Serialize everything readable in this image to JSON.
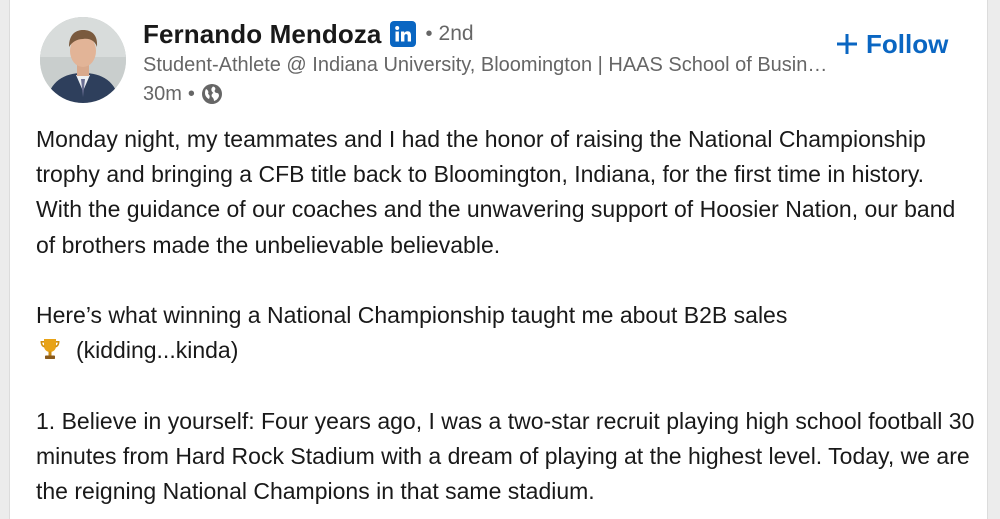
{
  "author": {
    "name": "Fernando Mendoza",
    "badge_icon": "linkedin-badge-icon",
    "separator": "•",
    "connection_degree": "2nd",
    "headline": "Student-Athlete @ Indiana University, Bloomington | HAAS School of Business",
    "time_ago": "30m",
    "meta_separator": "•",
    "visibility_icon": "globe-icon"
  },
  "follow_button": {
    "label": "Follow",
    "icon": "plus-icon"
  },
  "post": {
    "paragraph_1": "Monday night, my teammates and I had the honor of raising the National Championship trophy and bringing a CFB title back to Bloomington, Indiana, for the first time in history. With the guidance of our coaches and the unwavering support of Hoosier Nation, our band of brothers made the unbelievable believable.",
    "paragraph_2_line_1": "Here’s what winning a National Championship taught me about B2B sales",
    "paragraph_2_emoji": "trophy-icon",
    "paragraph_2_line_2": "(kidding...kinda)",
    "paragraph_3": "1. Believe in yourself: Four years ago, I was a two-star recruit playing high school football 30 minutes from Hard Rock Stadium with a dream of playing at the highest level. Today, we are the reigning National Champions in that same stadium."
  },
  "colors": {
    "brand_blue": "#0a66c2",
    "text_primary": "#191919",
    "text_secondary": "#666666",
    "card_background": "#ffffff"
  }
}
